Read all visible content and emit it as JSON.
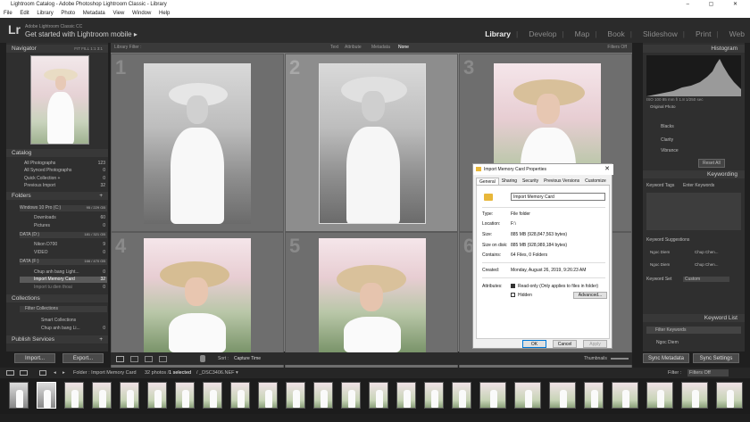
{
  "window": {
    "title": "Lightroom Catalog - Adobe Photoshop Lightroom Classic - Library",
    "controls": "– ▢ ✕"
  },
  "menu": [
    "File",
    "Edit",
    "Library",
    "Photo",
    "Metadata",
    "View",
    "Window",
    "Help"
  ],
  "identity": {
    "logo": "Lr",
    "line1": "Adobe Lightroom Classic CC",
    "line2": "Get started with Lightroom mobile",
    "arrow": "▸"
  },
  "modules": [
    {
      "label": "Library",
      "active": true
    },
    {
      "label": "Develop"
    },
    {
      "label": "Map"
    },
    {
      "label": "Book"
    },
    {
      "label": "Slideshow"
    },
    {
      "label": "Print"
    },
    {
      "label": "Web"
    }
  ],
  "left": {
    "navigator": {
      "title": "Navigator",
      "zoom": "FIT   FILL   1:1   3:1"
    },
    "catalog": {
      "title": "Catalog",
      "items": [
        {
          "label": "All Photographs",
          "count": "123"
        },
        {
          "label": "All Synced Photographs",
          "count": "0"
        },
        {
          "label": "Quick Collection +",
          "count": "0"
        },
        {
          "label": "Previous Import",
          "count": "32"
        }
      ]
    },
    "folders": {
      "title": "Folders",
      "add": "+",
      "volumes": [
        {
          "name": "Windows 10 Pro (C:)",
          "size": "95 / 229 GB"
        },
        {
          "name": "DATA (D:)",
          "size": "181 / 321 GB"
        },
        {
          "name": "DATA (F:)",
          "size": "166 / 470 GB"
        }
      ],
      "items": [
        {
          "label": "Downloads",
          "count": "60"
        },
        {
          "label": "Pictures",
          "count": "0"
        },
        {
          "label": "Nikon D700",
          "count": "9"
        },
        {
          "label": "VIDEO",
          "count": "0"
        },
        {
          "label": "Chup anh bang Light...",
          "count": "0"
        },
        {
          "label": "Import Memory Card",
          "count": "32"
        },
        {
          "label": "Import tu dien thoai",
          "count": "0"
        }
      ]
    },
    "collections": {
      "title": "Collections",
      "items": [
        {
          "label": "Filter Collections"
        },
        {
          "label": "Smart Collections"
        },
        {
          "label": "Chup anh bang Li...",
          "count": "0"
        }
      ]
    },
    "publish": {
      "title": "Publish Services",
      "add": "+"
    },
    "import_btn": "Import...",
    "export_btn": "Export..."
  },
  "filterbar": {
    "title": "Library Filter :",
    "tabs": [
      "Text",
      "Attribute",
      "Metadata",
      "None"
    ],
    "status": "Filters Off"
  },
  "grid": {
    "cells": [
      {
        "num": "1",
        "type": "bw"
      },
      {
        "num": "2",
        "type": "bw",
        "selected": true
      },
      {
        "num": "3",
        "type": "col"
      },
      {
        "num": "4",
        "type": "col"
      },
      {
        "num": "5",
        "type": "col"
      },
      {
        "num": "6",
        "type": "col"
      }
    ]
  },
  "toolbar": {
    "sort_label": "Sort :",
    "sort_value": "Capture Time",
    "thumbs": "Thumbnails"
  },
  "right": {
    "histogram": {
      "title": "Histogram",
      "info": "ISO 100   85 mm   f/ 1.8   1/250 sec",
      "original": "Original Photo"
    },
    "quick": {
      "rows": [
        "Blacks",
        "Clarity",
        "Vibrance"
      ],
      "reset": "Reset All"
    },
    "keywording": {
      "title": "Keywording",
      "tags_label": "Keyword Tags",
      "tags_value": "Enter Keywords",
      "suggest": "Keyword Suggestions",
      "sugg_items": [
        "Ngoc Diem",
        "Chup Chen...",
        "Ngoc Diem",
        "Chup Chen..."
      ],
      "set_label": "Keyword Set",
      "set_value": "Custom"
    },
    "keywordlist": {
      "title": "Keyword List",
      "filter": "Filter Keywords",
      "items": [
        "Ngoc Diem"
      ]
    },
    "sync_meta": "Sync Metadata",
    "sync_settings": "Sync Settings"
  },
  "filmhead": {
    "path": "Folder : Import Memory Card",
    "info": "32 photos /",
    "selected": "1 selected",
    "file": "/ _DSC3406.NEF ▾",
    "filter": "Filter :",
    "filter_value": "Filters Off"
  },
  "film": {
    "count": 26
  },
  "dialog": {
    "title": "Import Memory Card Properties",
    "close": "✕",
    "tabs": [
      "General",
      "Sharing",
      "Security",
      "Previous Versions",
      "Customize"
    ],
    "name": "Import Memory Card",
    "rows": [
      {
        "label": "Type:",
        "value": "File folder"
      },
      {
        "label": "Location:",
        "value": "F:\\"
      },
      {
        "label": "Size:",
        "value": "885 MB (928,847,563 bytes)"
      },
      {
        "label": "Size on disk:",
        "value": "885 MB (928,989,184 bytes)"
      },
      {
        "label": "Contains:",
        "value": "64 Files, 0 Folders"
      },
      {
        "label": "Created:",
        "value": "Monday, August 26, 2019, 9:26:23 AM"
      },
      {
        "label": "Attributes:",
        "value": "Read-only (Only applies to files in folder)"
      }
    ],
    "hidden": "Hidden",
    "advanced": "Advanced...",
    "ok": "OK",
    "cancel": "Cancel",
    "apply": "Apply"
  }
}
